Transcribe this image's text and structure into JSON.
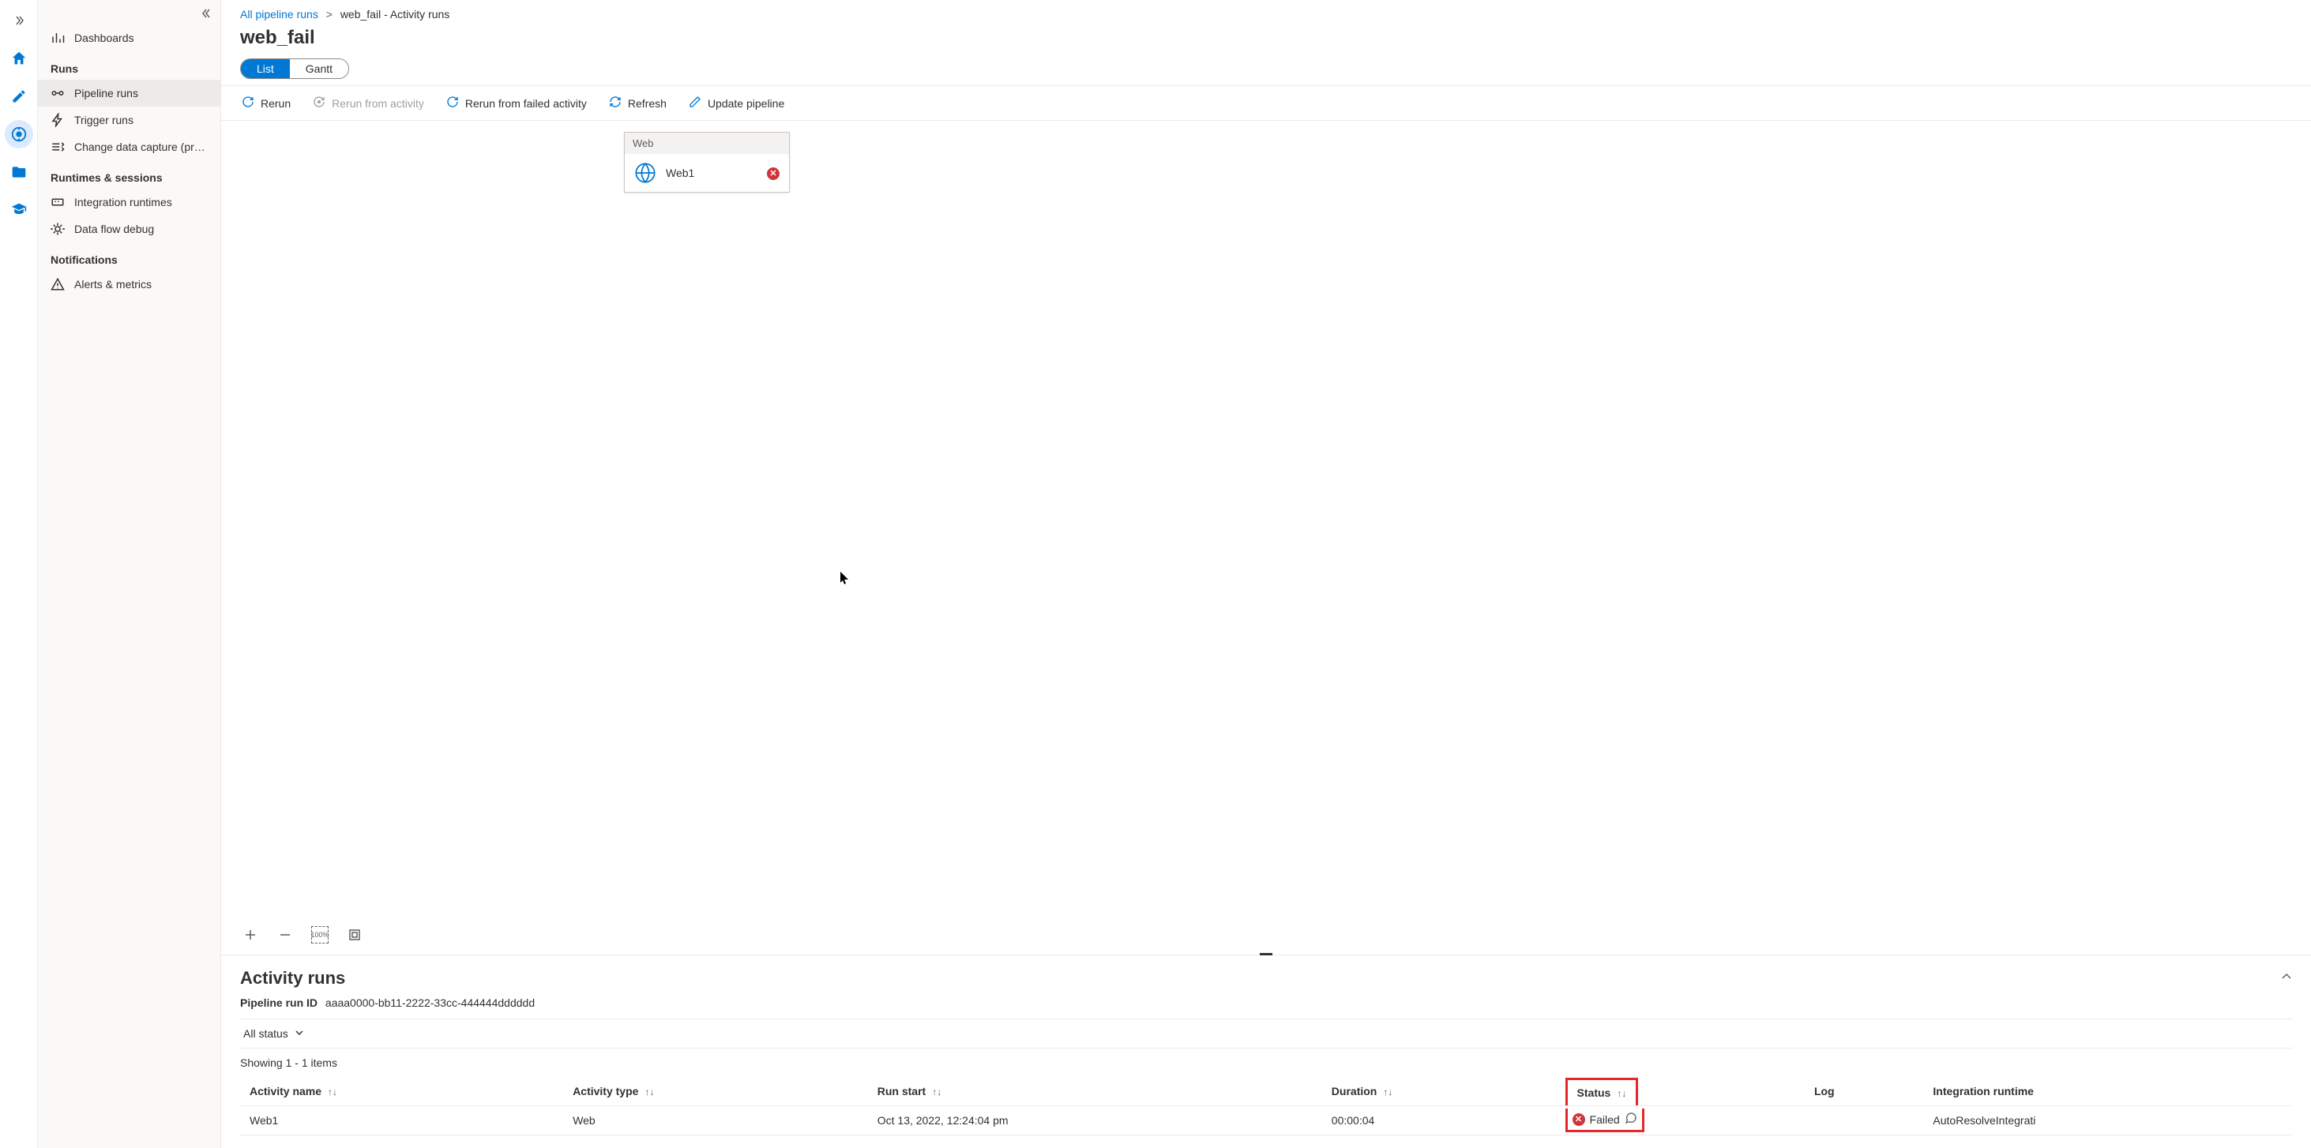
{
  "sidebar": {
    "top_item": {
      "label": "Dashboards"
    },
    "sections": {
      "runs": {
        "title": "Runs",
        "items": [
          {
            "label": "Pipeline runs",
            "active": true
          },
          {
            "label": "Trigger runs"
          },
          {
            "label": "Change data capture (previ..."
          }
        ]
      },
      "runtimes": {
        "title": "Runtimes & sessions",
        "items": [
          {
            "label": "Integration runtimes"
          },
          {
            "label": "Data flow debug"
          }
        ]
      },
      "notifications": {
        "title": "Notifications",
        "items": [
          {
            "label": "Alerts & metrics"
          }
        ]
      }
    }
  },
  "breadcrumb": {
    "root": "All pipeline runs",
    "current": "web_fail - Activity runs"
  },
  "page": {
    "title": "web_fail",
    "view_list": "List",
    "view_gantt": "Gantt"
  },
  "toolbar": {
    "rerun": "Rerun",
    "rerun_from_activity": "Rerun from activity",
    "rerun_from_failed": "Rerun from failed activity",
    "refresh": "Refresh",
    "update_pipeline": "Update pipeline"
  },
  "canvas": {
    "node_type": "Web",
    "node_name": "Web1"
  },
  "activity_runs": {
    "title": "Activity runs",
    "run_id_label": "Pipeline run ID",
    "run_id": "aaaa0000-bb11-2222-33cc-444444dddddd",
    "filter_status": "All status",
    "showing": "Showing 1 - 1 items",
    "columns": {
      "activity_name": "Activity name",
      "activity_type": "Activity type",
      "run_start": "Run start",
      "duration": "Duration",
      "status": "Status",
      "log": "Log",
      "integration_runtime": "Integration runtime"
    },
    "rows": [
      {
        "name": "Web1",
        "type": "Web",
        "start": "Oct 13, 2022, 12:24:04 pm",
        "duration": "00:00:04",
        "status": "Failed",
        "runtime": "AutoResolveIntegrati"
      }
    ]
  }
}
